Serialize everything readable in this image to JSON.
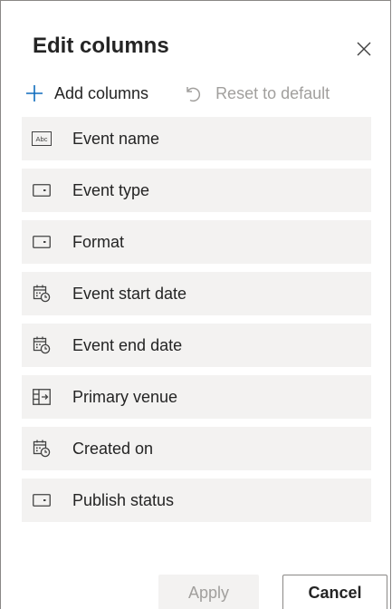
{
  "panel": {
    "title": "Edit columns",
    "close_icon": "close-icon"
  },
  "toolbar": {
    "add_label": "Add columns",
    "add_icon": "plus-icon",
    "reset_label": "Reset to default",
    "reset_icon": "undo-icon",
    "accent_color": "#0f6cbd"
  },
  "columns": [
    {
      "label": "Event name",
      "icon": "text-field-icon"
    },
    {
      "label": "Event type",
      "icon": "option-set-icon"
    },
    {
      "label": "Format",
      "icon": "option-set-icon"
    },
    {
      "label": "Event start date",
      "icon": "calendar-clock-icon"
    },
    {
      "label": "Event end date",
      "icon": "calendar-clock-icon"
    },
    {
      "label": "Primary venue",
      "icon": "lookup-icon"
    },
    {
      "label": "Created on",
      "icon": "calendar-clock-icon"
    },
    {
      "label": "Publish status",
      "icon": "option-set-icon"
    }
  ],
  "footer": {
    "apply_label": "Apply",
    "cancel_label": "Cancel"
  }
}
